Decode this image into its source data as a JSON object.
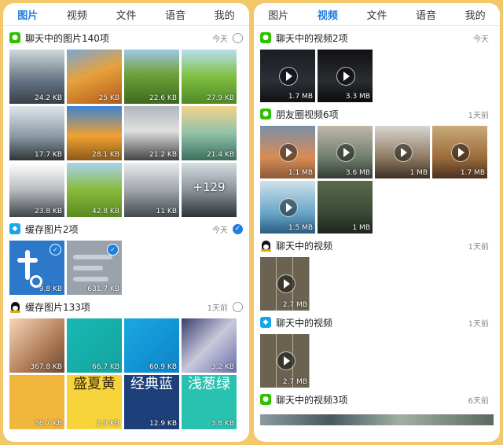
{
  "left": {
    "tabs": [
      {
        "label": "图片",
        "active": true
      },
      {
        "label": "视频",
        "active": false
      },
      {
        "label": "文件",
        "active": false
      },
      {
        "label": "语音",
        "active": false
      },
      {
        "label": "我的",
        "active": false
      }
    ],
    "sections": [
      {
        "app": "wechat",
        "title": "聊天中的图片140项",
        "date": "今天",
        "checked": false,
        "items": [
          {
            "size": "24.2 KB"
          },
          {
            "size": "25 KB"
          },
          {
            "size": "22.6 KB"
          },
          {
            "size": "27.9 KB"
          },
          {
            "size": "17.7 KB"
          },
          {
            "size": "28.1 KB"
          },
          {
            "size": "21.2 KB"
          },
          {
            "size": "21.4 KB"
          },
          {
            "size": "23.8 KB"
          },
          {
            "size": "42.8 KB"
          },
          {
            "size": "11 KB"
          },
          {
            "more": "+129"
          }
        ]
      },
      {
        "app": "qq-blue",
        "title": "缓存图片2项",
        "date": "今天",
        "checked": true,
        "items": [
          {
            "size": "9.8 KB",
            "selected": true
          },
          {
            "size": "631.7 KB",
            "selected": true
          }
        ]
      },
      {
        "app": "qq",
        "title": "缓存图片133项",
        "date": "1天前",
        "checked": false,
        "items": [
          {
            "size": "367.8 KB"
          },
          {
            "size": "66.7 KB"
          },
          {
            "size": "60.9 KB"
          },
          {
            "size": "3.2 KB"
          },
          {
            "size": "36.7 KB"
          },
          {
            "size": "2.9 KB",
            "text": "盛夏黄"
          },
          {
            "size": "12.9 KB",
            "text": "经典蓝"
          },
          {
            "size": "3.8 KB",
            "text": "浅葱绿"
          }
        ]
      }
    ]
  },
  "right": {
    "tabs": [
      {
        "label": "图片",
        "active": false
      },
      {
        "label": "视频",
        "active": true
      },
      {
        "label": "文件",
        "active": false
      },
      {
        "label": "语音",
        "active": false
      },
      {
        "label": "我的",
        "active": false
      }
    ],
    "sections": [
      {
        "app": "wechat",
        "title": "聊天中的视频2项",
        "date": "今天",
        "items": [
          {
            "size": "1.7 MB"
          },
          {
            "size": "3.3 MB"
          }
        ]
      },
      {
        "app": "wechat",
        "title": "朋友圈视频6项",
        "date": "1天前",
        "items": [
          {
            "size": "1.1 MB"
          },
          {
            "size": "3.6 MB"
          },
          {
            "size": "1 MB"
          },
          {
            "size": "1.7 MB"
          },
          {
            "size": "1.5 MB"
          },
          {
            "size": "1 MB"
          }
        ]
      },
      {
        "app": "qq",
        "title": "聊天中的视频",
        "date": "1天前",
        "items": [
          {
            "size": "2.7 MB"
          }
        ]
      },
      {
        "app": "qq-blue",
        "title": "聊天中的视频",
        "date": "1天前",
        "items": [
          {
            "size": "2.7 MB"
          }
        ]
      },
      {
        "app": "wechat",
        "title": "聊天中的视频3项",
        "date": "6天前",
        "items": []
      }
    ]
  }
}
